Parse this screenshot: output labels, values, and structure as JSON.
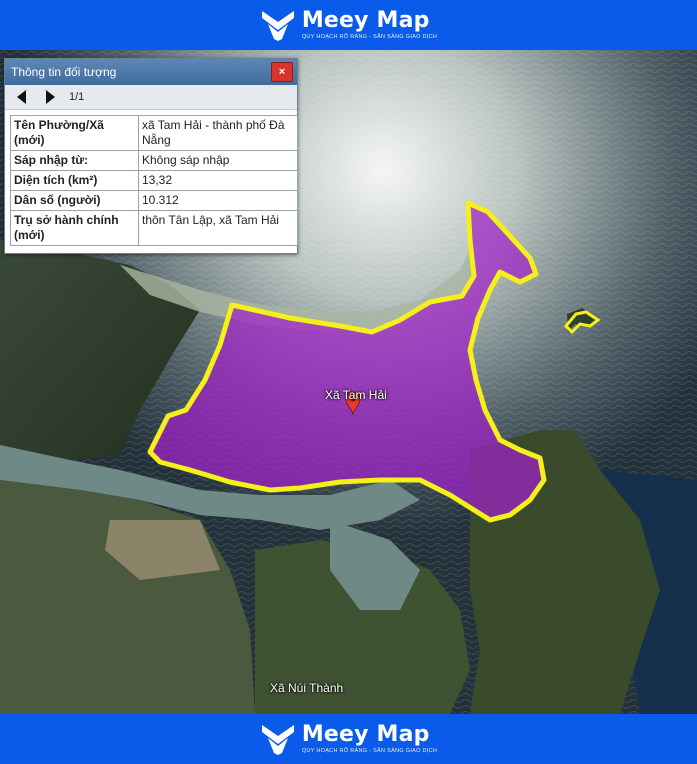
{
  "brand": {
    "name": "Meey Map",
    "tagline": "QUY HOẠCH RÕ RÀNG - SẴN SÀNG GIAO DỊCH"
  },
  "map": {
    "labels": {
      "selected_area": "Xã Tam Hải",
      "nearby_area": "Xã Núi Thành"
    },
    "highlight_colors": {
      "fill": "#a020c8",
      "outline": "#f5ef1a",
      "pin": "#e53935"
    }
  },
  "info_panel": {
    "title": "Thông tin đối tượng",
    "close_icon": "×",
    "pager": {
      "current": "1/1"
    },
    "rows": [
      {
        "key": "Tên Phường/Xã (mới)",
        "value": "xã Tam Hải - thành phố Đà Nẵng"
      },
      {
        "key": "Sáp nhập từ:",
        "value": "Không sáp nhập"
      },
      {
        "key": "Diện tích (km²)",
        "value": "13,32"
      },
      {
        "key": "Dân số (người)",
        "value": "10.312"
      },
      {
        "key": "Trụ sở hành chính (mới)",
        "value": "thôn Tân Lập, xã Tam Hải"
      }
    ]
  }
}
